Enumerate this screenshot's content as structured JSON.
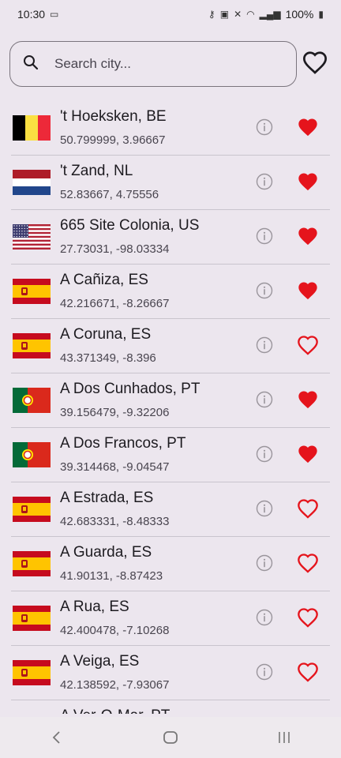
{
  "status": {
    "time": "10:30",
    "battery": "100%"
  },
  "search": {
    "placeholder": "Search city..."
  },
  "cities": [
    {
      "name": "'t Hoeksken, BE",
      "coords": "50.799999, 3.96667",
      "flag": "BE",
      "favorite": true
    },
    {
      "name": "'t Zand, NL",
      "coords": "52.83667, 4.75556",
      "flag": "NL",
      "favorite": true
    },
    {
      "name": "665 Site Colonia, US",
      "coords": "27.73031, -98.03334",
      "flag": "US",
      "favorite": true
    },
    {
      "name": "A Cañiza, ES",
      "coords": "42.216671, -8.26667",
      "flag": "ES",
      "favorite": true
    },
    {
      "name": "A Coruna, ES",
      "coords": "43.371349, -8.396",
      "flag": "ES",
      "favorite": false
    },
    {
      "name": "A Dos Cunhados, PT",
      "coords": "39.156479, -9.32206",
      "flag": "PT",
      "favorite": true
    },
    {
      "name": "A Dos Francos, PT",
      "coords": "39.314468, -9.04547",
      "flag": "PT",
      "favorite": true
    },
    {
      "name": "A Estrada, ES",
      "coords": "42.683331, -8.48333",
      "flag": "ES",
      "favorite": false
    },
    {
      "name": "A Guarda, ES",
      "coords": "41.90131, -8.87423",
      "flag": "ES",
      "favorite": false
    },
    {
      "name": "A Rua, ES",
      "coords": "42.400478, -7.10268",
      "flag": "ES",
      "favorite": false
    },
    {
      "name": "A Veiga, ES",
      "coords": "42.138592, -7.93067",
      "flag": "ES",
      "favorite": false
    },
    {
      "name": "A Ver-O-Mar, PT",
      "coords": "",
      "flag": "PT",
      "favorite": false
    }
  ],
  "colors": {
    "favorite": "#e5141c",
    "background": "#ece6ee"
  },
  "icons": {
    "search": "search-icon",
    "info": "info-icon",
    "favorite": "heart-icon"
  }
}
